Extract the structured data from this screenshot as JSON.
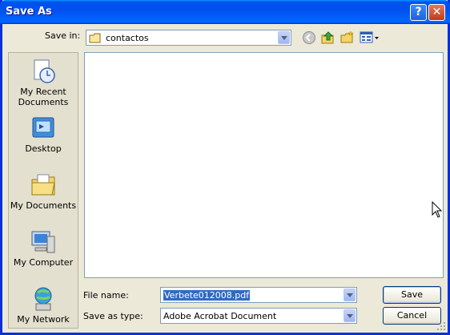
{
  "window": {
    "title": "Save As"
  },
  "titlebar_buttons": {
    "help": "?",
    "close": "✕"
  },
  "save_in": {
    "label": "Save in:",
    "value": "contactos"
  },
  "places": [
    {
      "label_line1": "My Recent",
      "label_line2": "Documents"
    },
    {
      "label_line1": "Desktop",
      "label_line2": ""
    },
    {
      "label_line1": "My Documents",
      "label_line2": ""
    },
    {
      "label_line1": "My Computer",
      "label_line2": ""
    },
    {
      "label_line1": "My Network",
      "label_line2": ""
    }
  ],
  "file_name": {
    "label": "File name:",
    "value": "Verbete012008.pdf"
  },
  "save_as_type": {
    "label": "Save as type:",
    "value": "Adobe Acrobat Document"
  },
  "buttons": {
    "save": "Save",
    "cancel": "Cancel"
  },
  "colors": {
    "title_bar": "#0054e3",
    "selection": "#316ac5",
    "face": "#ece9d8"
  }
}
